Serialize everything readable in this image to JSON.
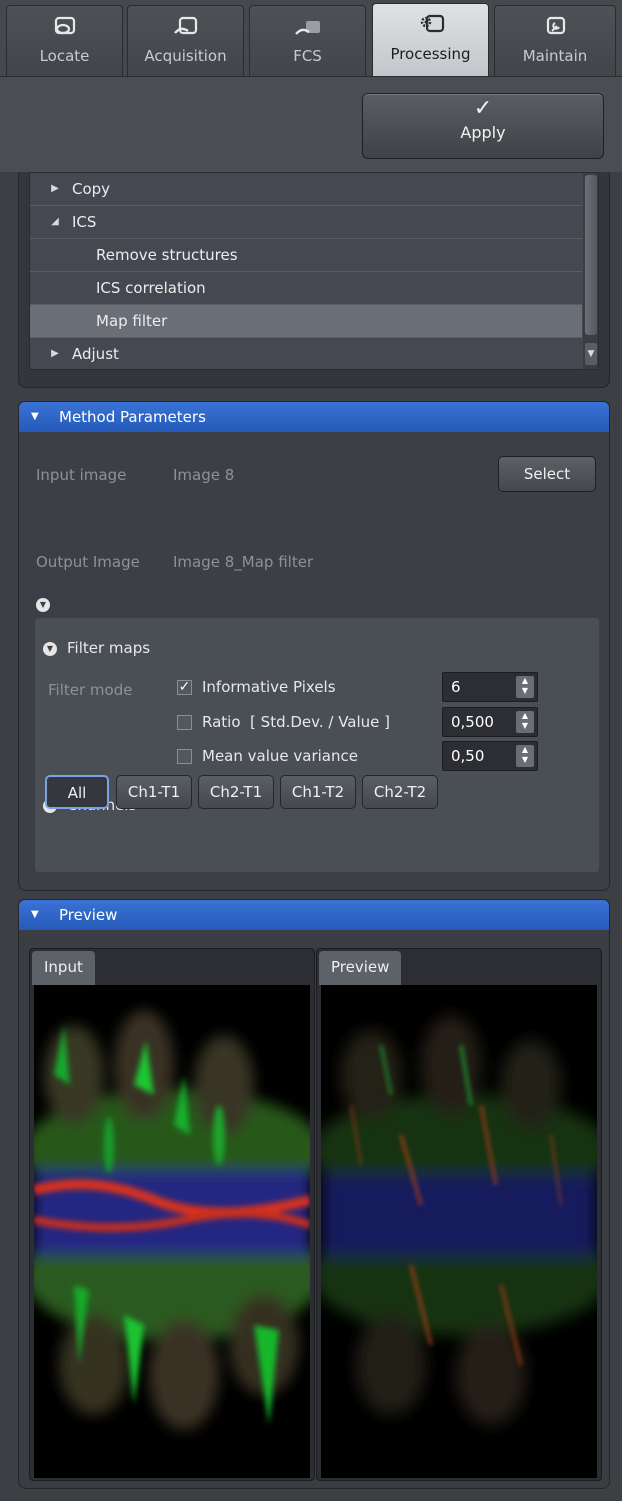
{
  "tabs": [
    {
      "label": "Locate",
      "icon": "locate-icon"
    },
    {
      "label": "Acquisition",
      "icon": "acquisition-icon"
    },
    {
      "label": "FCS",
      "icon": "fcs-icon"
    },
    {
      "label": "Processing",
      "icon": "processing-icon"
    },
    {
      "label": "Maintain",
      "icon": "maintain-icon"
    }
  ],
  "active_tab": "Processing",
  "apply": {
    "check": "✓",
    "label": "Apply"
  },
  "tree": {
    "items": [
      {
        "label": "Copy",
        "expanded": false,
        "level": 0
      },
      {
        "label": "ICS",
        "expanded": true,
        "level": 0
      },
      {
        "label": "Remove structures",
        "level": 1
      },
      {
        "label": "ICS correlation",
        "level": 1
      },
      {
        "label": "Map filter",
        "level": 1,
        "selected": true
      },
      {
        "label": "Adjust",
        "expanded": false,
        "level": 0
      }
    ]
  },
  "method": {
    "header": "Method Parameters",
    "input_label": "Input image",
    "input_value": "Image 8",
    "select_label": "Select",
    "output_label": "Output Image",
    "output_value": "Image 8_Map filter",
    "filter_maps_label": "Filter maps",
    "filter_mode_label": "Filter mode",
    "options": [
      {
        "label": "Informative Pixels",
        "checked": true,
        "value": "6"
      },
      {
        "label": "Ratio  [ Std.Dev. / Value ]",
        "checked": false,
        "value": "0,500"
      },
      {
        "label": "Mean value variance",
        "checked": false,
        "value": "0,50"
      }
    ],
    "channels_label": "Channels",
    "channels": [
      "All",
      "Ch1-T1",
      "Ch2-T1",
      "Ch1-T2",
      "Ch2-T2"
    ],
    "active_channel": "All"
  },
  "preview": {
    "header": "Preview",
    "input_tab": "Input",
    "preview_tab": "Preview"
  },
  "colors": {
    "accent": "#2f66c9",
    "channel_green": "#19c93a",
    "channel_red": "#e0331f",
    "channel_blue": "#2e2fa8"
  }
}
